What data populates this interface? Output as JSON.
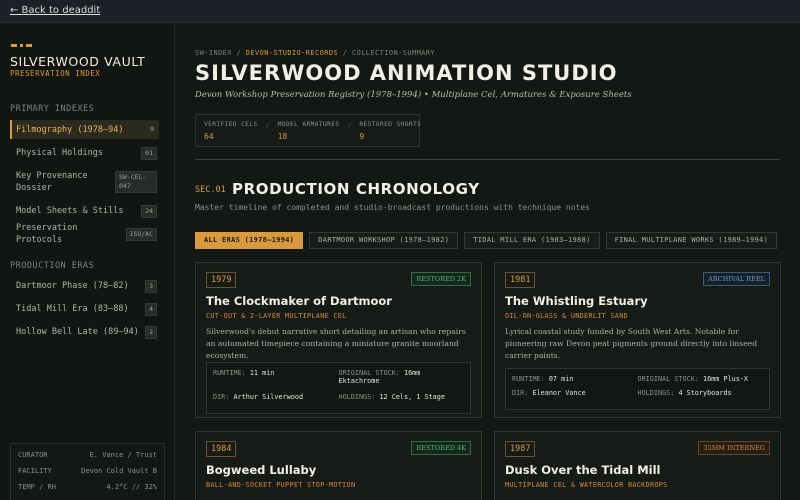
{
  "topbar": {
    "back_label": "← Back to deaddit"
  },
  "sidebar": {
    "title": "SILVERWOOD VAULT",
    "subtitle": "PRESERVATION INDEX",
    "primary_heading": "PRIMARY INDEXES",
    "primary_items": [
      {
        "label": "Filmography (1978–94)",
        "badge": "9",
        "active": true
      },
      {
        "label": "Physical Holdings",
        "badge": "01"
      },
      {
        "label": "Key Provenance Dossier",
        "badge": "SW-CEL-047"
      },
      {
        "label": "Model Sheets & Stills",
        "badge": "24"
      },
      {
        "label": "Preservation Protocols",
        "badge": "ISO/AC"
      }
    ],
    "eras_heading": "PRODUCTION ERAS",
    "era_items": [
      {
        "label": "Dartmoor Phase (78–82)",
        "badge": "3"
      },
      {
        "label": "Tidal Mill Era (83–88)",
        "badge": "4"
      },
      {
        "label": "Hollow Bell Late (89–94)",
        "badge": "2"
      }
    ],
    "footer": [
      {
        "key": "CURATOR",
        "value": "E. Vance / Trust"
      },
      {
        "key": "FACILITY",
        "value": "Devon Cold Vault B"
      },
      {
        "key": "TEMP / RH",
        "value": "4.2°C // 32%"
      }
    ]
  },
  "main": {
    "breadcrumb": [
      "SW-INDEX",
      "DEVON-STUDIO-RECORDS",
      "COLLECTION-SUMMARY"
    ],
    "breadcrumb_sep": "/",
    "title": "SILVERWOOD ANIMATION STUDIO",
    "subtitle": "Devon Workshop Preservation Registry (1978–1994) • Multiplane Cel, Armatures & Exposure Sheets",
    "stats": [
      {
        "label": "VERIFIED CELS",
        "value": "64"
      },
      {
        "label": "MODEL ARMATURES",
        "value": "18"
      },
      {
        "label": "RESTORED SHORTS",
        "value": "9"
      }
    ],
    "section": {
      "num": "SEC.01",
      "title": "PRODUCTION CHRONOLOGY",
      "desc": "Master timeline of completed and studio-broadcast productions with technique notes"
    },
    "tabs": [
      {
        "label": "ALL ERAS (1978–1994)",
        "active": true
      },
      {
        "label": "DARTMOOR WORKSHOP (1978–1982)"
      },
      {
        "label": "TIDAL MILL ERA (1983–1988)"
      },
      {
        "label": "FINAL MULTIPLANE WORKS (1989–1994)"
      }
    ],
    "cards": [
      {
        "year": "1979",
        "tag": "RESTORED 2K",
        "tag_color": "#4dbb7a",
        "title": "The Clockmaker of Dartmoor",
        "technique": "CUT-OUT & 2-LAYER MULTIPLANE CEL",
        "desc": "Silverwood's debut narrative short detailing an artisan who repairs an automated timepiece containing a miniature granite moorland ecosystem.",
        "runtime_label": "RUNTIME:",
        "runtime": "11 min",
        "stock_label": "ORIGINAL STOCK:",
        "stock": "16mm Ektachrome",
        "dir_label": "DIR:",
        "dir": "Arthur Silverwood",
        "holdings_label": "HOLDINGS:",
        "holdings": "12 Cels, 1 Stage"
      },
      {
        "year": "1981",
        "tag": "ARCHIVAL REEL",
        "tag_color": "#6e9cc0",
        "title": "The Whistling Estuary",
        "technique": "OIL-ON-GLASS & UNDERLIT SAND",
        "desc": "Lyrical coastal study funded by South West Arts. Notable for pioneering raw Devon peat pigments ground directly into linseed carrier paints.",
        "runtime_label": "RUNTIME:",
        "runtime": "07 min",
        "stock_label": "ORIGINAL STOCK:",
        "stock": "16mm Plus-X",
        "dir_label": "DIR:",
        "dir": "Eleanor Vance",
        "holdings_label": "HOLDINGS:",
        "holdings": "4 Storyboards"
      },
      {
        "year": "1984",
        "tag": "RESTORED 4K",
        "tag_color": "#4dbb7a",
        "title": "Bogweed Lullaby",
        "technique": "BALL-AND-SOCKET PUPPET STOP-MOTION"
      },
      {
        "year": "1987",
        "tag": "35MM INTERNEG",
        "tag_color": "#d28a3a",
        "title": "Dusk Over the Tidal Mill",
        "technique": "MULTIPLANE CEL & WATERCOLOR BACKDROPS"
      }
    ]
  }
}
